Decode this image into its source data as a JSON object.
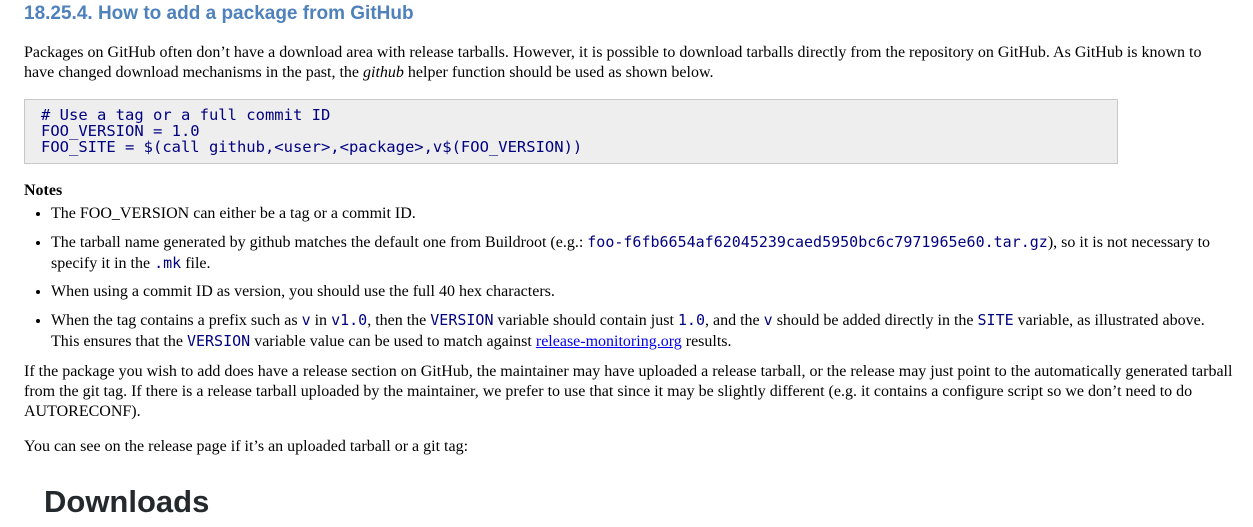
{
  "section": {
    "title": "18.25.4. How to add a package from GitHub"
  },
  "intro": {
    "text_before": "Packages on GitHub often don’t have a download area with release tarballs. However, it is possible to download tarballs directly from the repository on GitHub. As GitHub is known to have changed download mechanisms in the past, the ",
    "em": "github",
    "text_after": " helper function should be used as shown below."
  },
  "code": {
    "lines": [
      "# Use a tag or a full commit ID",
      "FOO_VERSION = 1.0",
      "FOO_SITE = $(call github,<user>,<package>,v$(FOO_VERSION))"
    ]
  },
  "notes": {
    "title": "Notes",
    "item1": "The FOO_VERSION can either be a tag or a commit ID.",
    "item2": {
      "t1": "The tarball name generated by github matches the default one from Buildroot (e.g.: ",
      "code1": "foo-f6fb6654af62045239caed5950bc6c7971965e60.tar.gz",
      "t2": "), so it is not necessary to specify it in the ",
      "code2": ".mk",
      "t3": " file."
    },
    "item3": "When using a commit ID as version, you should use the full 40 hex characters.",
    "item4": {
      "t1": "When the tag contains a prefix such as ",
      "c1": "v",
      "t2": " in ",
      "c2": "v1.0",
      "t3": ", then the ",
      "c3": "VERSION",
      "t4": " variable should contain just ",
      "c4": "1.0",
      "t5": ", and the ",
      "c5": "v",
      "t6": " should be added directly in the ",
      "c6": "SITE",
      "t7": " variable, as illustrated above. This ensures that the ",
      "c7": "VERSION",
      "t8": " variable value can be used to match against ",
      "link": "release-monitoring.org",
      "t9": " results."
    }
  },
  "para2": "If the package you wish to add does have a release section on GitHub, the maintainer may have uploaded a release tarball, or the release may just point to the automatically generated tarball from the git tag. If there is a release tarball uploaded by the maintainer, we prefer to use that since it may be slightly different (e.g. it contains a configure script so we don’t need to do AUTORECONF).",
  "para3": "You can see on the release page if it’s an uploaded tarball or a git tag:",
  "figure": {
    "heading": "Downloads"
  },
  "colors": {
    "heading": "#4f81bd",
    "code_text": "#000080",
    "link": "#0000ee"
  }
}
